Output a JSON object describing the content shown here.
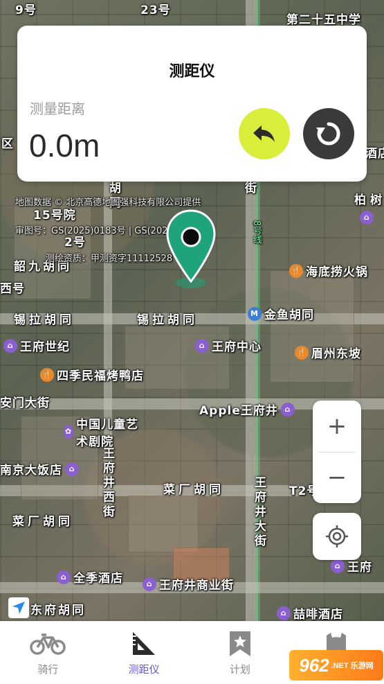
{
  "card": {
    "title": "测距仪",
    "distance_label": "测量距离",
    "distance_value": "0.0m"
  },
  "map": {
    "copyright": {
      "line1": "地图数据 © 北京高德地图强科技有限公司提供",
      "line2": "审图号：GS(2025)0183号 | GS(2025)0217号",
      "line3": "测绘资质：甲测资字11112528"
    },
    "labels": [
      "9号",
      "23号",
      "第二十五中学",
      "区",
      "酒店",
      "柏树",
      "15号院",
      "2号",
      "韶九胡同",
      "西号",
      "锡拉胡同",
      "锡拉胡同",
      "金鱼胡同",
      "海底捞火锅",
      "王府世纪",
      "王府中心",
      "眉州东坡",
      "四季民福烤鸭店",
      "安门大街",
      "Apple王府井",
      "中国儿童艺术剧院",
      "南京大饭店",
      "王府井西街",
      "菜厂胡同",
      "菜厂胡同",
      "王府井大街",
      "T2号",
      "全季酒店",
      "王府井商业街",
      "喆啡酒店",
      "东府胡同",
      "王府",
      "8号线",
      "街",
      "胡同",
      "王府"
    ]
  },
  "controls": {
    "zoom_in": "+",
    "zoom_out": "−"
  },
  "nav": {
    "items": [
      {
        "label": "骑行",
        "icon": "bicycle-icon"
      },
      {
        "label": "测距仪",
        "icon": "ruler-triangle-icon"
      },
      {
        "label": "计划",
        "icon": "bookmark-star-icon"
      },
      {
        "label": "我的",
        "icon": "profile-icon"
      }
    ]
  },
  "watermark": {
    "main": "962",
    "sub": ".NET 乐游网"
  },
  "colors": {
    "accent": "#6a5acd",
    "undo_button": "#d9ee3a",
    "reset_button": "#3a3a3a",
    "marker": "#1fa37a"
  }
}
